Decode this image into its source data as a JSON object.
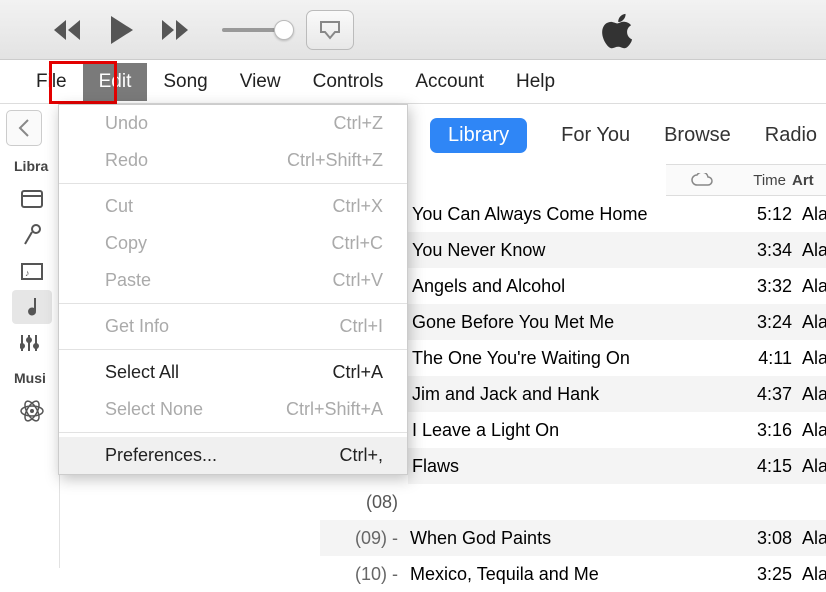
{
  "menubar": [
    "File",
    "Edit",
    "Song",
    "View",
    "Controls",
    "Account",
    "Help"
  ],
  "edit_menu": {
    "undo": {
      "label": "Undo",
      "shortcut": "Ctrl+Z",
      "enabled": false
    },
    "redo": {
      "label": "Redo",
      "shortcut": "Ctrl+Shift+Z",
      "enabled": false
    },
    "cut": {
      "label": "Cut",
      "shortcut": "Ctrl+X",
      "enabled": false
    },
    "copy": {
      "label": "Copy",
      "shortcut": "Ctrl+C",
      "enabled": false
    },
    "paste": {
      "label": "Paste",
      "shortcut": "Ctrl+V",
      "enabled": false
    },
    "get_info": {
      "label": "Get Info",
      "shortcut": "Ctrl+I",
      "enabled": false
    },
    "select_all": {
      "label": "Select All",
      "shortcut": "Ctrl+A",
      "enabled": true
    },
    "select_none": {
      "label": "Select None",
      "shortcut": "Ctrl+Shift+A",
      "enabled": false
    },
    "preferences": {
      "label": "Preferences...",
      "shortcut": "Ctrl+,",
      "enabled": true
    }
  },
  "sidebar": {
    "library_label": "Libra",
    "music_label": "Musi"
  },
  "tabs": {
    "library": "Library",
    "for_you": "For You",
    "browse": "Browse",
    "radio": "Radio"
  },
  "columns": {
    "time": "Time",
    "artist": "Art"
  },
  "tracks_top": [
    {
      "title": "You Can Always Come Home",
      "time": "5:12",
      "artist": "Ala"
    },
    {
      "title": "You Never Know",
      "time": "3:34",
      "artist": "Ala"
    },
    {
      "title": "Angels and Alcohol",
      "time": "3:32",
      "artist": "Ala"
    },
    {
      "title": "Gone Before You Met Me",
      "time": "3:24",
      "artist": "Ala"
    },
    {
      "title": "The One You're Waiting On",
      "time": "4:11",
      "artist": "Ala"
    },
    {
      "title": "Jim and Jack and Hank",
      "time": "4:37",
      "artist": "Ala"
    },
    {
      "title": "I Leave a Light On",
      "time": "3:16",
      "artist": "Ala"
    },
    {
      "title": "Flaws",
      "time": "4:15",
      "artist": "Ala"
    }
  ],
  "tracks_bottom_prefix": "(08)",
  "tracks_bottom": [
    {
      "num": "(09) -",
      "title": "When God Paints",
      "time": "3:08",
      "artist": "Ala"
    },
    {
      "num": "(10) -",
      "title": "Mexico, Tequila and Me",
      "time": "3:25",
      "artist": "Ala"
    }
  ]
}
